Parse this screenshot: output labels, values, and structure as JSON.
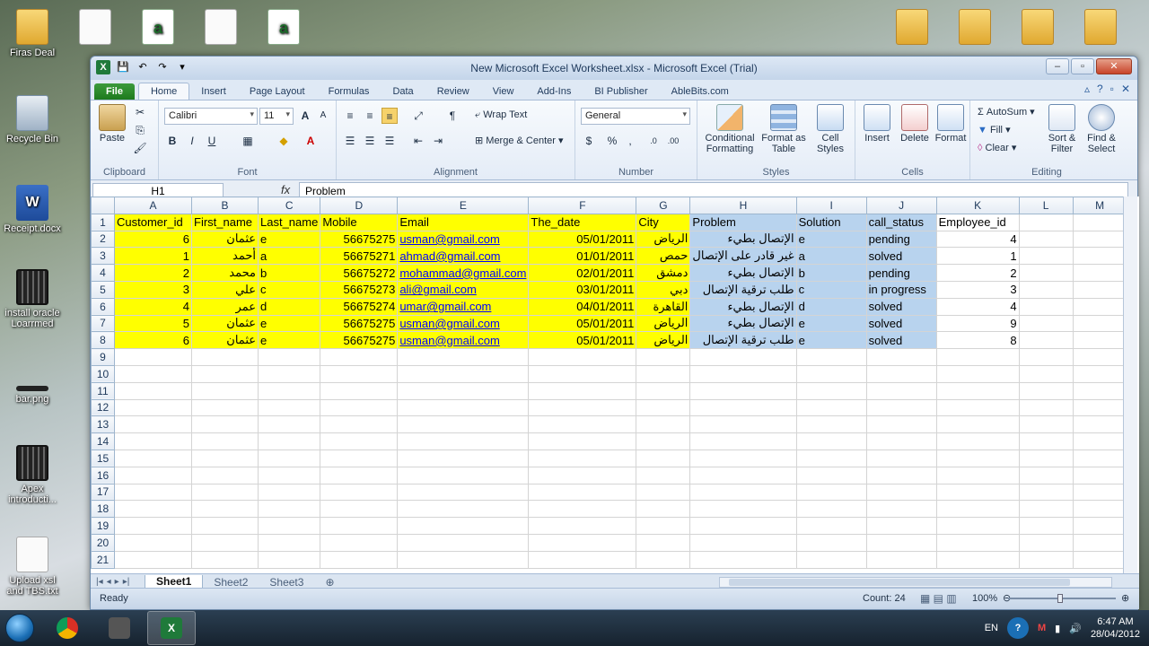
{
  "desktop": {
    "icons": [
      {
        "label": "Firas Deal",
        "type": "folder"
      },
      {
        "label": "Recycle Bin",
        "type": "bin"
      },
      {
        "label": "Receipt.docx",
        "type": "word"
      },
      {
        "label": "install oracle Loarrmed",
        "type": "film"
      },
      {
        "label": "bar.png",
        "type": "doc"
      },
      {
        "label": "Apex introducti...",
        "type": "film"
      },
      {
        "label": "Upload xsl and TBS.txt",
        "type": "doc"
      }
    ]
  },
  "window": {
    "title": "New Microsoft Excel Worksheet.xlsx - Microsoft Excel (Trial)"
  },
  "ribbon": {
    "tabs": [
      "File",
      "Home",
      "Insert",
      "Page Layout",
      "Formulas",
      "Data",
      "Review",
      "View",
      "Add-Ins",
      "BI Publisher",
      "AbleBits.com"
    ],
    "active_tab": "Home",
    "clipboard": {
      "paste": "Paste",
      "label": "Clipboard"
    },
    "font": {
      "name": "Calibri",
      "size": "11",
      "label": "Font"
    },
    "alignment": {
      "wrap_text": "Wrap Text",
      "merge_center": "Merge & Center",
      "label": "Alignment"
    },
    "number": {
      "format": "General",
      "label": "Number"
    },
    "styles": {
      "conditional": "Conditional Formatting",
      "format_table": "Format as Table",
      "cell_styles": "Cell Styles",
      "label": "Styles"
    },
    "cells": {
      "insert": "Insert",
      "delete": "Delete",
      "format": "Format",
      "label": "Cells"
    },
    "editing": {
      "autosum": "AutoSum",
      "fill": "Fill",
      "clear": "Clear",
      "sort_filter": "Sort & Filter",
      "find_select": "Find & Select",
      "label": "Editing"
    }
  },
  "formula_bar": {
    "name_box": "H1",
    "fx": "fx",
    "content": "Problem"
  },
  "sheet": {
    "columns": [
      "A",
      "B",
      "C",
      "D",
      "E",
      "F",
      "G",
      "H",
      "I",
      "J",
      "K",
      "L",
      "M"
    ],
    "headers": [
      "Customer_id",
      "First_name",
      "Last_name",
      "Mobile",
      "Email",
      "The_date",
      "City",
      "Problem",
      "Solution",
      "call_status",
      "Employee_id",
      "",
      ""
    ],
    "rows": [
      [
        "6",
        "عثمان",
        "e",
        "56675275",
        "usman@gmail.com",
        "05/01/2011",
        "الرياض",
        "الإتصال بطيء",
        "e",
        "pending",
        "4"
      ],
      [
        "1",
        "أحمد",
        "a",
        "56675271",
        "ahmad@gmail.com",
        "01/01/2011",
        "حمص",
        "غير قادر على الإتصال",
        "a",
        "solved",
        "1"
      ],
      [
        "2",
        "محمد",
        "b",
        "56675272",
        "mohammad@gmail.com",
        "02/01/2011",
        "دمشق",
        "الإتصال بطيء",
        "b",
        "pending",
        "2"
      ],
      [
        "3",
        "علي",
        "c",
        "56675273",
        "ali@gmail.com",
        "03/01/2011",
        "دبي",
        "طلب ترقية الإتصال",
        "c",
        "in progress",
        "3"
      ],
      [
        "4",
        "عمر",
        "d",
        "56675274",
        "umar@gmail.com",
        "04/01/2011",
        "القاهرة",
        "الإتصال بطيء",
        "d",
        "solved",
        "4"
      ],
      [
        "5",
        "عثمان",
        "e",
        "56675275",
        "usman@gmail.com",
        "05/01/2011",
        "الرياض",
        "الإتصال بطيء",
        "e",
        "solved",
        "9"
      ],
      [
        "6",
        "عثمان",
        "e",
        "56675275",
        "usman@gmail.com",
        "05/01/2011",
        "الرياض",
        "طلب ترقية الإتصال",
        "e",
        "solved",
        "8"
      ]
    ],
    "row_numbers": [
      "1",
      "2",
      "3",
      "4",
      "5",
      "6",
      "7",
      "8",
      "9",
      "10",
      "11",
      "12",
      "13",
      "14",
      "15",
      "16",
      "17",
      "18",
      "19",
      "20",
      "21"
    ],
    "tabs": [
      "Sheet1",
      "Sheet2",
      "Sheet3"
    ],
    "active_tab": "Sheet1"
  },
  "status_bar": {
    "ready": "Ready",
    "count": "Count: 24",
    "zoom": "100%"
  },
  "taskbar": {
    "lang": "EN",
    "time": "6:47 AM",
    "date": "28/04/2012"
  },
  "colors": {
    "highlight_yellow": "#ffff00",
    "selection_blue": "#b8d3ee",
    "file_tab_green": "#1d7a1d"
  }
}
